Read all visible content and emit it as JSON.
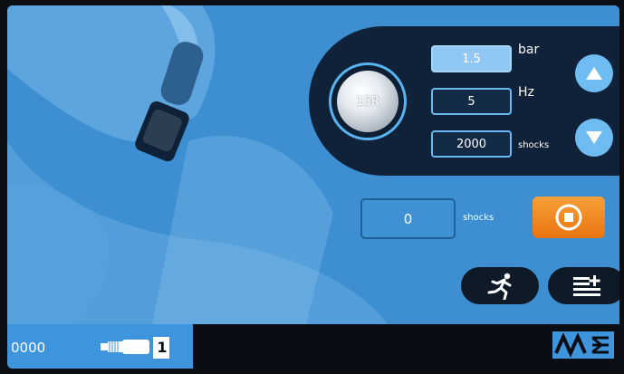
{
  "tip": {
    "label": "15R"
  },
  "parameters": [
    {
      "value": "1.5",
      "unit": "bar",
      "active": true
    },
    {
      "value": "5",
      "unit": "Hz",
      "active": false
    },
    {
      "value": "2000",
      "unit": "shocks",
      "active": false
    }
  ],
  "counter": {
    "value": "0",
    "unit": "shocks"
  },
  "footer": {
    "total_count": "0000",
    "handpiece_number": "1"
  },
  "colors": {
    "background": "#3d8fd2",
    "panel": "#10223a",
    "accent": "#6fbcf2",
    "stop": "#ef8a1f"
  },
  "icons": {
    "increase": "triangle-up-icon",
    "decrease": "triangle-down-icon",
    "stop": "stop-icon",
    "mode": "running-man-icon",
    "menu": "list-add-icon",
    "handpiece": "handpiece-icon",
    "logo": "brand-logo"
  }
}
